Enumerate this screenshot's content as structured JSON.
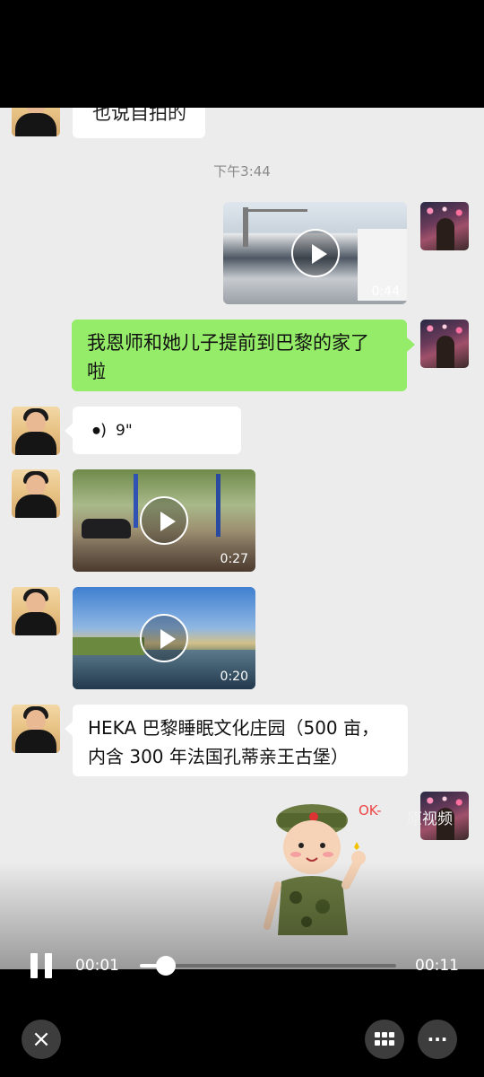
{
  "chat": {
    "timestamp": "下午3:44",
    "partial_bubble_text": "也说自拍的",
    "messages": [
      {
        "type": "video",
        "side": "right",
        "duration": "0:44"
      },
      {
        "type": "text",
        "side": "right",
        "text_line1": "我恩师和她儿子提前到巴黎的家了",
        "text_line2": "啦"
      },
      {
        "type": "voice",
        "side": "left",
        "duration": "9\""
      },
      {
        "type": "video",
        "side": "left",
        "duration": "0:27"
      },
      {
        "type": "video",
        "side": "left",
        "duration": "0:20"
      },
      {
        "type": "text",
        "side": "left",
        "text_line1": "HEKA 巴黎睡眠文化庄园（500 亩，",
        "text_line2": "内含 300 年法国孔蒂亲王古堡）"
      },
      {
        "type": "sticker",
        "side": "right",
        "caption": "OK-"
      }
    ]
  },
  "player": {
    "original_video_label": "原视频",
    "current_time": "00:01",
    "total_time": "00:11",
    "progress_fraction": 0.1
  },
  "bottom_bar": {
    "close_icon": "×",
    "grid_icon": "grid-icon",
    "more_icon": "···"
  },
  "colors": {
    "chat_background": "#ececec",
    "green_bubble": "#95ec69",
    "white_bubble": "#ffffff"
  }
}
